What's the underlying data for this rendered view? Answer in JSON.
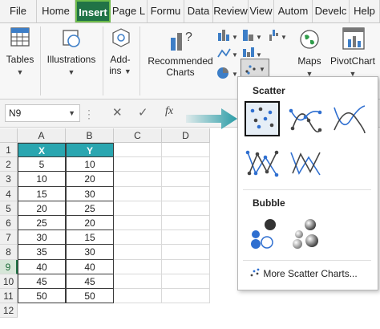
{
  "ribbon_tabs": [
    "File",
    "Home",
    "Insert",
    "Page L",
    "Formu",
    "Data",
    "Review",
    "View",
    "Autom",
    "Develc",
    "Help"
  ],
  "active_tab": "Insert",
  "ribbon_groups": {
    "tables": "Tables",
    "illustrations": "Illustrations",
    "addins_line1": "Add-",
    "addins_line2": "ins",
    "recommended_line1": "Recommended",
    "recommended_line2": "Charts",
    "maps": "Maps",
    "pivotchart": "PivotChart"
  },
  "formula_bar": {
    "name_box": "N9",
    "fx": "fx"
  },
  "columns": [
    "A",
    "B",
    "C",
    "D"
  ],
  "rows": [
    "1",
    "2",
    "3",
    "4",
    "5",
    "6",
    "7",
    "8",
    "9",
    "10",
    "11",
    "12"
  ],
  "selected_row": "9",
  "table": {
    "headers": [
      "X",
      "Y"
    ],
    "x_values": [
      "5",
      "10",
      "15",
      "20",
      "25",
      "30",
      "35",
      "40",
      "45",
      "50"
    ],
    "y_values": [
      "10",
      "20",
      "30",
      "25",
      "20",
      "15",
      "30",
      "40",
      "45",
      "50"
    ]
  },
  "dropdown": {
    "scatter_heading": "Scatter",
    "bubble_heading": "Bubble",
    "more_link": "More Scatter Charts..."
  },
  "colors": {
    "accent": "#217346",
    "table_header": "#2aa6b0",
    "arrow": "#2a9ca6",
    "chart_blue": "#2f6fd0",
    "chart_dark": "#444444"
  }
}
